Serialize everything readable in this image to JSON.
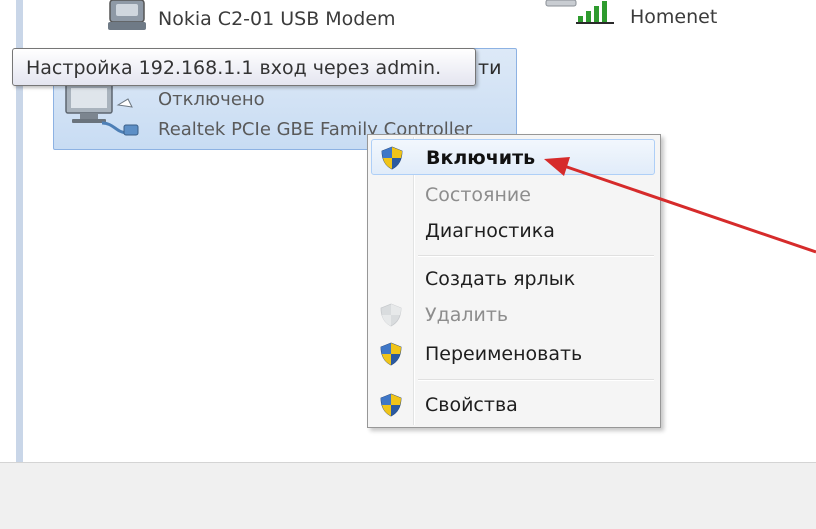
{
  "connections": {
    "nokia": {
      "name": "Nokia C2-01 USB Modem"
    },
    "homenet": {
      "name": "Homenet"
    },
    "ethernet": {
      "name_fragment": "ти",
      "status": "Отключено",
      "device": "Realtek PCIe GBE Family Controller"
    }
  },
  "tooltip": {
    "text": "Настройка 192.168.1.1 вход через admin."
  },
  "context_menu": {
    "items": [
      {
        "label": "Включить",
        "state": "highlighted",
        "icon": "shield-icon"
      },
      {
        "label": "Состояние",
        "state": "disabled",
        "icon": ""
      },
      {
        "label": "Диагностика",
        "state": "normal",
        "icon": ""
      },
      {
        "label": "Создать ярлык",
        "state": "normal",
        "icon": ""
      },
      {
        "label": "Удалить",
        "state": "disabled",
        "icon": "shield-icon"
      },
      {
        "label": "Переименовать",
        "state": "normal",
        "icon": "shield-icon"
      },
      {
        "label": "Свойства",
        "state": "normal",
        "icon": "shield-icon"
      }
    ]
  },
  "colors": {
    "annotation_arrow": "#d62b2b",
    "selection": "#c8dcf3",
    "menu_highlight": "#e1ecf9"
  }
}
